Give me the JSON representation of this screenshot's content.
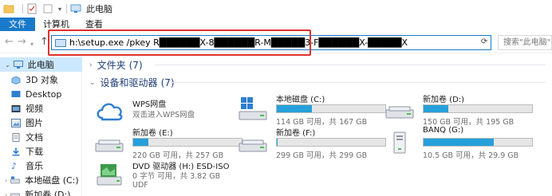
{
  "window": {
    "title": "此电脑"
  },
  "ribbon": {
    "tabs": [
      "文件",
      "计算机",
      "查看"
    ]
  },
  "address": {
    "command": "h:\\setup.exe /pkey  R██████X-8██████R-M█████3-F██████X-█████X",
    "search_placeholder": "搜索\"此电脑\""
  },
  "sidebar": {
    "items": [
      {
        "label": "此电脑",
        "icon": "computer-icon",
        "selected": true
      },
      {
        "label": "3D 对象",
        "icon": "3d-objects-icon"
      },
      {
        "label": "Desktop",
        "icon": "desktop-icon"
      },
      {
        "label": "视频",
        "icon": "video-icon"
      },
      {
        "label": "图片",
        "icon": "pictures-icon"
      },
      {
        "label": "文档",
        "icon": "documents-icon"
      },
      {
        "label": "下载",
        "icon": "downloads-icon"
      },
      {
        "label": "音乐",
        "icon": "music-icon"
      },
      {
        "label": "本地磁盘 (C:)",
        "icon": "drive-icon"
      },
      {
        "label": "新加卷 (D:)",
        "icon": "drive-icon"
      }
    ]
  },
  "groups": {
    "folders": {
      "label": "文件夹",
      "count": "(7)"
    },
    "devices": {
      "label": "设备和驱动器",
      "count": "(7)"
    }
  },
  "wps": {
    "name": "WPS网盘",
    "desc": "双击进入WPS网盘"
  },
  "drives": {
    "c": {
      "name": "本地磁盘 (C:)",
      "info": "114 GB 可用，共 167 GB",
      "used_fraction": 0.32
    },
    "d": {
      "name": "新加卷 (D:)",
      "info": "150 GB 可用，共 195 GB",
      "used_fraction": 0.23
    },
    "e": {
      "name": "新加卷 (E:)",
      "info": "220 GB 可用，共 257 GB",
      "used_fraction": 0.14
    },
    "f": {
      "name": "新加卷 (F:)",
      "info": "299 GB 可用，共 299 GB",
      "used_fraction": 0.005
    },
    "g": {
      "name": "BANQ (G:)",
      "info": "10.5 GB 可用，共 29.9 GB",
      "used_fraction": 0.65
    },
    "h": {
      "name": "DVD 驱动器 (H:) ESD-ISO",
      "info": "0 字节 可用，共 3.82 GB",
      "fs": "UDF"
    }
  },
  "colors": {
    "accent": "#1979ca",
    "bar_fill": "#26a0da",
    "highlight": "#e0302a",
    "selected": "#cce8ff"
  }
}
